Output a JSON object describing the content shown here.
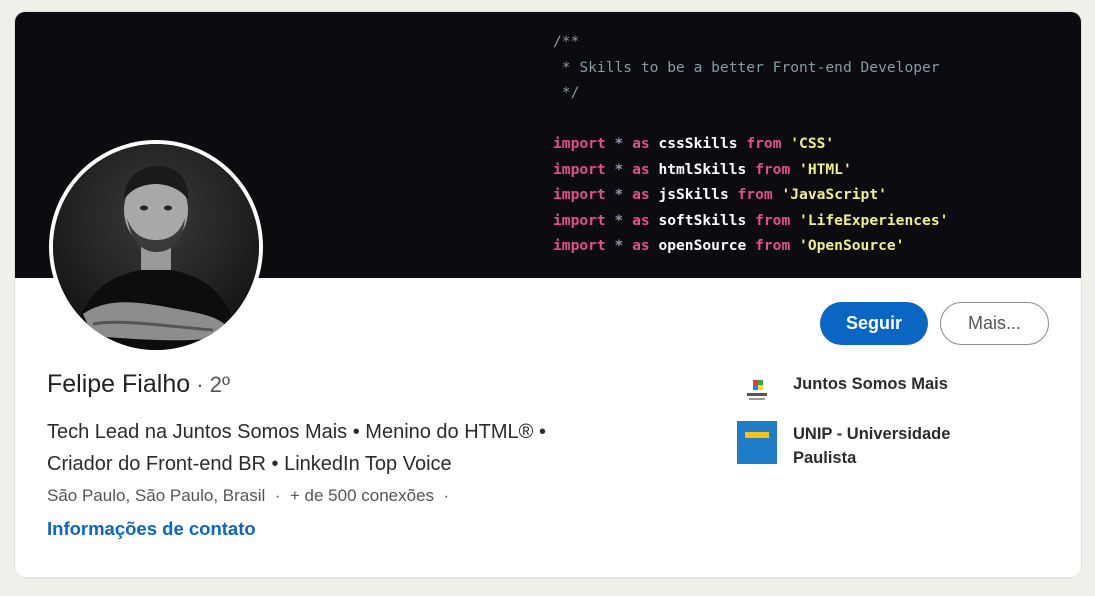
{
  "banner": {
    "code_lines": [
      [
        {
          "t": "/**",
          "c": "comment"
        }
      ],
      [
        {
          "t": " * Skills to be a better Front-end Developer",
          "c": "comment"
        }
      ],
      [
        {
          "t": " */",
          "c": "comment"
        }
      ],
      [
        {
          "t": "",
          "c": "ident"
        }
      ],
      [
        {
          "t": "import",
          "c": "kw"
        },
        {
          "t": " * ",
          "c": "ast"
        },
        {
          "t": "as",
          "c": "kw"
        },
        {
          "t": " cssSkills ",
          "c": "ident"
        },
        {
          "t": "from",
          "c": "kw"
        },
        {
          "t": " 'CSS'",
          "c": "str"
        }
      ],
      [
        {
          "t": "import",
          "c": "kw"
        },
        {
          "t": " * ",
          "c": "ast"
        },
        {
          "t": "as",
          "c": "kw"
        },
        {
          "t": " htmlSkills ",
          "c": "ident"
        },
        {
          "t": "from",
          "c": "kw"
        },
        {
          "t": " 'HTML'",
          "c": "str"
        }
      ],
      [
        {
          "t": "import",
          "c": "kw"
        },
        {
          "t": " * ",
          "c": "ast"
        },
        {
          "t": "as",
          "c": "kw"
        },
        {
          "t": " jsSkills ",
          "c": "ident"
        },
        {
          "t": "from",
          "c": "kw"
        },
        {
          "t": " 'JavaScript'",
          "c": "str"
        }
      ],
      [
        {
          "t": "import",
          "c": "kw"
        },
        {
          "t": " * ",
          "c": "ast"
        },
        {
          "t": "as",
          "c": "kw"
        },
        {
          "t": " softSkills ",
          "c": "ident"
        },
        {
          "t": "from",
          "c": "kw"
        },
        {
          "t": " 'LifeExperiences'",
          "c": "str"
        }
      ],
      [
        {
          "t": "import",
          "c": "kw"
        },
        {
          "t": " * ",
          "c": "ast"
        },
        {
          "t": "as",
          "c": "kw"
        },
        {
          "t": " openSource ",
          "c": "ident"
        },
        {
          "t": "from",
          "c": "kw"
        },
        {
          "t": " 'OpenSource'",
          "c": "str"
        }
      ]
    ]
  },
  "actions": {
    "follow_label": "Seguir",
    "more_label": "Mais..."
  },
  "profile": {
    "name": "Felipe Fialho",
    "separator": " · ",
    "degree": "2º",
    "headline_line1": "Tech Lead na Juntos Somos Mais • Menino do HTML® •",
    "headline_line2": "Criador do Front-end BR • LinkedIn Top Voice",
    "location": "São Paulo, São Paulo, Brasil",
    "connections": "+ de 500 conexões",
    "location_separator": "  ·  ",
    "connections_suffix": "  ·",
    "contact_link": "Informações de contato"
  },
  "experience": [
    {
      "name": "Juntos Somos Mais",
      "logo_icon": "juntos-somos-mais-logo"
    },
    {
      "name": "UNIP - Universidade Paulista",
      "logo_icon": "unip-logo"
    }
  ],
  "colors": {
    "brand_blue": "#0a66c2",
    "banner_bg": "#0c0b0f",
    "keyword": "#e0518a",
    "string": "#f0ef8a"
  }
}
